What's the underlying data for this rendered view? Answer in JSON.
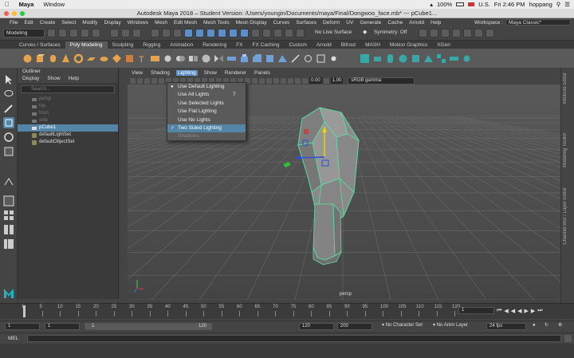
{
  "mac_menubar": {
    "app": "Maya",
    "items": [
      "Window"
    ],
    "right": {
      "battery": "100%",
      "flag": "U.S.",
      "clock": "Fri 2:46 PM",
      "user": "hoppang"
    }
  },
  "window_title": "Autodesk Maya 2018 – Student Version: /Users/youngin/Documents/maya/Final/Dongwoo_face.mb* --- pCube1...",
  "maya_menu": {
    "items": [
      "File",
      "Edit",
      "Create",
      "Select",
      "Modify",
      "Display",
      "Windows",
      "Mesh",
      "Edit Mesh",
      "Mesh Tools",
      "Mesh Display",
      "Curves",
      "Surfaces",
      "Deform",
      "UV",
      "Generate",
      "Cache",
      "Arnold",
      "Help"
    ],
    "workspace_label": "Workspace :",
    "workspace_value": "Maya Classic*"
  },
  "status_line": {
    "mode": "Modeling",
    "live_surface": "No Live Surface",
    "symmetry": "Symmetry: Off"
  },
  "shelf_tabs": [
    "Curves / Surfaces",
    "Poly Modeling",
    "Sculpting",
    "Rigging",
    "Animation",
    "Rendering",
    "FX",
    "FX Caching",
    "Custom",
    "Arnold",
    "Bifrost",
    "MASH",
    "Motion Graphics",
    "XGen"
  ],
  "shelf_active_tab": "Poly Modeling",
  "outliner": {
    "title": "Outliner",
    "menu": [
      "Display",
      "Show",
      "Help"
    ],
    "search_placeholder": "Search...",
    "items": [
      {
        "label": "persp",
        "state": "dim"
      },
      {
        "label": "top",
        "state": "dim"
      },
      {
        "label": "front",
        "state": "dim"
      },
      {
        "label": "side",
        "state": "dim"
      },
      {
        "label": "pCube1",
        "state": "selected"
      },
      {
        "label": "defaultLightSet",
        "state": "normal"
      },
      {
        "label": "defaultObjectSet",
        "state": "normal"
      }
    ]
  },
  "viewport": {
    "menu": [
      "View",
      "Shading",
      "Lighting",
      "Show",
      "Renderer",
      "Panels"
    ],
    "open_menu": "Lighting",
    "field_a": "0.00",
    "field_b": "1.00",
    "color_space": "sRGB gamma",
    "camera_label": "persp"
  },
  "lighting_menu": [
    {
      "label": "Use Default Lighting",
      "mark": "dot",
      "shortcut": ""
    },
    {
      "label": "Use All Lights",
      "mark": "",
      "shortcut": "7"
    },
    {
      "label": "Use Selected Lights",
      "mark": "",
      "shortcut": ""
    },
    {
      "label": "Use Flat Lighting",
      "mark": "",
      "shortcut": ""
    },
    {
      "label": "Use No Lights",
      "mark": "",
      "shortcut": ""
    },
    {
      "label": "Two Sided Lighting",
      "mark": "check",
      "shortcut": ""
    },
    {
      "label": "Shadows",
      "mark": "",
      "shortcut": ""
    }
  ],
  "right_panel_labels": [
    "Attribute Editor",
    "Modeling Toolkit",
    "Channel Box / Layer Editor"
  ],
  "timeline": {
    "ticks": [
      "1",
      "5",
      "10",
      "15",
      "20",
      "25",
      "30",
      "35",
      "40",
      "45",
      "50",
      "55",
      "60",
      "65",
      "70",
      "75",
      "80",
      "85",
      "90",
      "95",
      "100",
      "105",
      "110",
      "115",
      "120"
    ],
    "current_frame": "1"
  },
  "range": {
    "start": "1",
    "start_inner": "1",
    "slider_start": "1",
    "slider_end": "120",
    "end_inner": "120",
    "end": "200",
    "character_set": "No Character Set",
    "anim_layer": "No Anim Layer",
    "fps": "24 fps"
  },
  "mel_label": "MEL",
  "colors": {
    "accent": "#5285a6",
    "wire": "#5ee0a0",
    "menu_highlight": "#5d8ec7"
  }
}
